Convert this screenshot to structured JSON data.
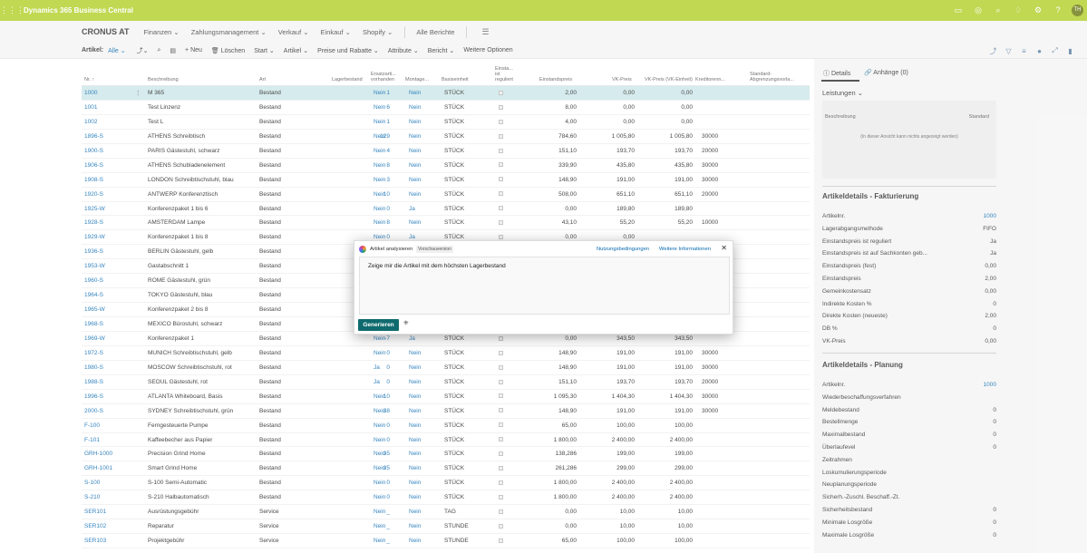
{
  "app": {
    "title": "Dynamics 365 Business Central",
    "user_initials": "TH"
  },
  "icons": {
    "waffle": "waffle-icon",
    "top": [
      "document-icon",
      "help-circle-icon",
      "search-icon",
      "bell-icon",
      "gear-icon",
      "question-icon"
    ]
  },
  "menu": {
    "company": "CRONUS AT",
    "items": [
      "Finanzen ⌄",
      "Zahlungsmanagement ⌄",
      "Verkauf ⌄",
      "Einkauf ⌄",
      "Shopify ⌄"
    ],
    "reports": "Alle Berichte",
    "more": "☰"
  },
  "toolbar": {
    "label": "Artikel:",
    "filter": "Alle ⌄",
    "new": "+ Neu",
    "delete": "🗑 Löschen",
    "start": "Start ⌄",
    "item": "Artikel ⌄",
    "prices": "Preise und Rabatte ⌄",
    "attributes": "Attribute ⌄",
    "report": "Bericht ⌄",
    "more": "Weitere Optionen",
    "search": "⌕"
  },
  "columns": [
    "Nr. ↑",
    "Beschreibung",
    "Art",
    "Lagerbestand",
    "Ersatzarti... vorhanden",
    "Montage...",
    "Basiseinheit",
    "Einsta... ist reguliert",
    "Einstandspreis",
    "VK-Preis",
    "VK-Preis (VK-Einheit)",
    "Kreditorenn...",
    "Standard-Abgrenzungsvorla..."
  ],
  "rows": [
    {
      "no": "1000",
      "desc": "M 365",
      "type": "Bestand",
      "inv": "1",
      "sub": "Nein",
      "asm": "Nein",
      "unit": "STÜCK",
      "cost": "2,00",
      "price": "0,00",
      "priceu": "0,00",
      "vendor": ""
    },
    {
      "no": "1001",
      "desc": "Test Linzenz",
      "type": "Bestand",
      "inv": "6",
      "sub": "Nein",
      "asm": "Nein",
      "unit": "STÜCK",
      "cost": "8,00",
      "price": "0,00",
      "priceu": "0,00",
      "vendor": ""
    },
    {
      "no": "1002",
      "desc": "Test L",
      "type": "Bestand",
      "inv": "1",
      "sub": "Nein",
      "asm": "Nein",
      "unit": "STÜCK",
      "cost": "4,00",
      "price": "0,00",
      "priceu": "0,00",
      "vendor": ""
    },
    {
      "no": "1896-S",
      "desc": "ATHENS Schreibtisch",
      "type": "Bestand",
      "inv": "129",
      "sub": "Nein",
      "asm": "Nein",
      "unit": "STÜCK",
      "cost": "784,60",
      "price": "1 005,80",
      "priceu": "1 005,80",
      "vendor": "30000"
    },
    {
      "no": "1900-S",
      "desc": "PARIS Gästestuhl, schwarz",
      "type": "Bestand",
      "inv": "4",
      "sub": "Nein",
      "asm": "Nein",
      "unit": "STÜCK",
      "cost": "151,10",
      "price": "193,70",
      "priceu": "193,70",
      "vendor": "20000"
    },
    {
      "no": "1906-S",
      "desc": "ATHENS Schubladenelement",
      "type": "Bestand",
      "inv": "8",
      "sub": "Nein",
      "asm": "Nein",
      "unit": "STÜCK",
      "cost": "339,90",
      "price": "435,80",
      "priceu": "435,80",
      "vendor": "30000"
    },
    {
      "no": "1908-S",
      "desc": "LONDON Schreibtischstuhl, blau",
      "type": "Bestand",
      "inv": "3",
      "sub": "Nein",
      "asm": "Nein",
      "unit": "STÜCK",
      "cost": "148,90",
      "price": "191,00",
      "priceu": "191,00",
      "vendor": "30000"
    },
    {
      "no": "1920-S",
      "desc": "ANTWERP Konferenztisch",
      "type": "Bestand",
      "inv": "10",
      "sub": "Nein",
      "asm": "Nein",
      "unit": "STÜCK",
      "cost": "508,00",
      "price": "651,10",
      "priceu": "651,10",
      "vendor": "20000"
    },
    {
      "no": "1925-W",
      "desc": "Konferenzpaket 1 bis 6",
      "type": "Bestand",
      "inv": "0",
      "sub": "Nein",
      "asm": "Ja",
      "unit": "STÜCK",
      "cost": "0,00",
      "price": "189,80",
      "priceu": "189,80",
      "vendor": ""
    },
    {
      "no": "1928-S",
      "desc": "AMSTERDAM Lampe",
      "type": "Bestand",
      "inv": "8",
      "sub": "Nein",
      "asm": "Nein",
      "unit": "STÜCK",
      "cost": "43,10",
      "price": "55,20",
      "priceu": "55,20",
      "vendor": "10000"
    },
    {
      "no": "1929-W",
      "desc": "Konferenzpaket 1 bis 8",
      "type": "Bestand",
      "inv": "0",
      "sub": "Nein",
      "asm": "Ja",
      "unit": "STÜCK",
      "cost": "0,00",
      "price": "0,00",
      "priceu": "",
      "vendor": ""
    },
    {
      "no": "1936-S",
      "desc": "BERLIN Gästestuhl, gelb",
      "type": "Bestand",
      "inv": "",
      "sub": "",
      "asm": "",
      "unit": "",
      "cost": "",
      "price": "",
      "priceu": "",
      "vendor": ""
    },
    {
      "no": "1953-W",
      "desc": "Gastabschnitt 1",
      "type": "Bestand",
      "inv": "",
      "sub": "",
      "asm": "",
      "unit": "",
      "cost": "",
      "price": "",
      "priceu": "",
      "vendor": ""
    },
    {
      "no": "1960-S",
      "desc": "ROME Gästestuhl, grün",
      "type": "Bestand",
      "inv": "",
      "sub": "",
      "asm": "",
      "unit": "",
      "cost": "",
      "price": "",
      "priceu": "",
      "vendor": ""
    },
    {
      "no": "1964-S",
      "desc": "TOKYO Gästestuhl, blau",
      "type": "Bestand",
      "inv": "",
      "sub": "",
      "asm": "",
      "unit": "",
      "cost": "",
      "price": "",
      "priceu": "",
      "vendor": ""
    },
    {
      "no": "1965-W",
      "desc": "Konferenzpaket 2 bis 8",
      "type": "Bestand",
      "inv": "",
      "sub": "",
      "asm": "",
      "unit": "",
      "cost": "",
      "price": "",
      "priceu": "",
      "vendor": ""
    },
    {
      "no": "1968-S",
      "desc": "MEXICO Bürostuhl, schwarz",
      "type": "Bestand",
      "inv": "",
      "sub": "",
      "asm": "",
      "unit": "",
      "cost": "",
      "price": "",
      "priceu": "",
      "vendor": ""
    },
    {
      "no": "1969-W",
      "desc": "Konferenzpaket 1",
      "type": "Bestand",
      "inv": "-7",
      "sub": "Nein",
      "asm": "Ja",
      "unit": "STÜCK",
      "cost": "0,00",
      "price": "343,50",
      "priceu": "343,50",
      "vendor": ""
    },
    {
      "no": "1972-S",
      "desc": "MUNICH Schreibtischstuhl, gelb",
      "type": "Bestand",
      "inv": "0",
      "sub": "Nein",
      "asm": "Nein",
      "unit": "STÜCK",
      "cost": "148,90",
      "price": "191,00",
      "priceu": "191,00",
      "vendor": "30000"
    },
    {
      "no": "1980-S",
      "desc": "MOSCOW Schreibtischstuhl, rot",
      "type": "Bestand",
      "inv": "0",
      "sub": "Ja",
      "asm": "Nein",
      "unit": "STÜCK",
      "cost": "148,90",
      "price": "191,00",
      "priceu": "191,00",
      "vendor": "30000"
    },
    {
      "no": "1988-S",
      "desc": "SEOUL Gästestuhl, rot",
      "type": "Bestand",
      "inv": "0",
      "sub": "Ja",
      "asm": "Nein",
      "unit": "STÜCK",
      "cost": "151,10",
      "price": "193,70",
      "priceu": "193,70",
      "vendor": "20000"
    },
    {
      "no": "1996-S",
      "desc": "ATLANTA Whiteboard, Basis",
      "type": "Bestand",
      "inv": "10",
      "sub": "Nein",
      "asm": "Nein",
      "unit": "STÜCK",
      "cost": "1 095,30",
      "price": "1 404,30",
      "priceu": "1 404,30",
      "vendor": "30000"
    },
    {
      "no": "2000-S",
      "desc": "SYDNEY Schreibtischstuhl, grün",
      "type": "Bestand",
      "inv": "38",
      "sub": "Nein",
      "asm": "Nein",
      "unit": "STÜCK",
      "cost": "148,90",
      "price": "191,00",
      "priceu": "191,00",
      "vendor": "30000"
    },
    {
      "no": "F-100",
      "desc": "Ferngesteuerte Pumpe",
      "type": "Bestand",
      "inv": "0",
      "sub": "Nein",
      "asm": "Nein",
      "unit": "STÜCK",
      "cost": "65,00",
      "price": "100,00",
      "priceu": "100,00",
      "vendor": ""
    },
    {
      "no": "F-101",
      "desc": "Kaffeebecher aus Papier",
      "type": "Bestand",
      "inv": "0",
      "sub": "Nein",
      "asm": "Nein",
      "unit": "STÜCK",
      "cost": "1 800,00",
      "price": "2 400,00",
      "priceu": "2 400,00",
      "vendor": ""
    },
    {
      "no": "GRH-1000",
      "desc": "Precision Grind Home",
      "type": "Bestand",
      "inv": "35",
      "sub": "Nein",
      "asm": "Nein",
      "unit": "STÜCK",
      "cost": "138,286",
      "price": "199,00",
      "priceu": "199,00",
      "vendor": ""
    },
    {
      "no": "GRH-1001",
      "desc": "Smart Grind Home",
      "type": "Bestand",
      "inv": "35",
      "sub": "Nein",
      "asm": "Nein",
      "unit": "STÜCK",
      "cost": "261,286",
      "price": "299,00",
      "priceu": "299,00",
      "vendor": ""
    },
    {
      "no": "S-100",
      "desc": "S-100 Semi-Automatic",
      "type": "Bestand",
      "inv": "0",
      "sub": "Nein",
      "asm": "Nein",
      "unit": "STÜCK",
      "cost": "1 800,00",
      "price": "2 400,00",
      "priceu": "2 400,00",
      "vendor": ""
    },
    {
      "no": "S-210",
      "desc": "S-210 Halbautomatisch",
      "type": "Bestand",
      "inv": "0",
      "sub": "Nein",
      "asm": "Nein",
      "unit": "STÜCK",
      "cost": "1 800,00",
      "price": "2 400,00",
      "priceu": "2 400,00",
      "vendor": ""
    },
    {
      "no": "SER101",
      "desc": "Ausrüstungsgebühr",
      "type": "Service",
      "inv": "_",
      "sub": "Nein",
      "asm": "Nein",
      "unit": "TAG",
      "cost": "0,00",
      "price": "10,00",
      "priceu": "10,00",
      "vendor": ""
    },
    {
      "no": "SER102",
      "desc": "Reparatur",
      "type": "Service",
      "inv": "_",
      "sub": "Nein",
      "asm": "Nein",
      "unit": "STUNDE",
      "cost": "0,00",
      "price": "10,00",
      "priceu": "10,00",
      "vendor": ""
    },
    {
      "no": "SER103",
      "desc": "Projektgebühr",
      "type": "Service",
      "inv": "_",
      "sub": "Nein",
      "asm": "Nein",
      "unit": "STUNDE",
      "cost": "65,00",
      "price": "100,00",
      "priceu": "100,00",
      "vendor": ""
    }
  ],
  "factbox": {
    "tab_details": "ⓘ Details",
    "tab_attach": "🔗 Anhänge (0)",
    "leistungen": "Leistungen ⌄",
    "box_col1": "Beschreibung",
    "box_col2": "Standard",
    "box_empty": "(In dieser Ansicht kann nichts angezeigt werden)",
    "sec1": "Artikeldetails - Fakturierung",
    "sec1_rows": [
      {
        "k": "Artikelnr.",
        "v": "1000"
      },
      {
        "k": "Lagerabgangsmethode",
        "v": "FIFO"
      },
      {
        "k": "Einstandspreis ist reguliert",
        "v": "Ja"
      },
      {
        "k": "Einstandspreis ist auf Sachkonten geb...",
        "v": "Ja"
      },
      {
        "k": "Einstandspreis (fest)",
        "v": "0,00"
      },
      {
        "k": "Einstandspreis",
        "v": "2,00"
      },
      {
        "k": "Gemeinkostensatz",
        "v": "0,00"
      },
      {
        "k": "Indirekte Kosten %",
        "v": "0"
      },
      {
        "k": "Direkte Kosten (neueste)",
        "v": "2,00"
      },
      {
        "k": "DB %",
        "v": "0"
      },
      {
        "k": "VK-Preis",
        "v": "0,00"
      }
    ],
    "sec2": "Artikeldetails - Planung",
    "sec2_rows": [
      {
        "k": "Artikelnr.",
        "v": "1000"
      },
      {
        "k": "Wiederbeschaffungsverfahren",
        "v": ""
      },
      {
        "k": "Meldebestand",
        "v": "0"
      },
      {
        "k": "Bestellmenge",
        "v": "0"
      },
      {
        "k": "Maximalbestand",
        "v": "0"
      },
      {
        "k": "Überlaufevel",
        "v": "0"
      },
      {
        "k": "Zeitrahmen",
        "v": ""
      },
      {
        "k": "Loskumulierungsperiode",
        "v": ""
      },
      {
        "k": "Neuplanungsperiode",
        "v": ""
      },
      {
        "k": "Sicherh.-Zuschl. Beschaff.-Zt.",
        "v": ""
      },
      {
        "k": "Sicherheitsbestand",
        "v": "0"
      },
      {
        "k": "Minimale Losgröße",
        "v": "0"
      },
      {
        "k": "Maximale Losgröße",
        "v": "0"
      }
    ]
  },
  "dialog": {
    "title": "Artikel analysieren",
    "badge": "Vorschauversion",
    "link1": "Nutzungsbedingungen",
    "link2": "Weitere Informationen",
    "close": "✕",
    "prompt": "Zeige mir die Artikel mit dem höchsten Lagerbestand",
    "generate": "Generieren",
    "copilot_icon": "⎈"
  },
  "colors": {
    "accent": "#b4d02e",
    "link": "#0a6ab0",
    "primary_button": "#0f6a6e",
    "selected_row": "#cde7ea"
  }
}
